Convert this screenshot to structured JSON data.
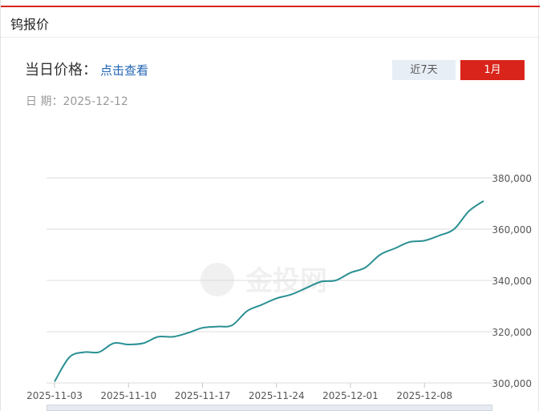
{
  "panel": {
    "title": "钨报价"
  },
  "price": {
    "label": "当日价格：",
    "link_text": "点击查看"
  },
  "date": {
    "label": "日 期：",
    "value": "2025-12-12"
  },
  "range_buttons": {
    "week": "近7天",
    "month": "1月",
    "selected": "month"
  },
  "watermark": {
    "text": "金投网"
  },
  "colors": {
    "accent": "#d9241b",
    "line": "#2a9093",
    "grid": "#dddddd",
    "link": "#1f64b4"
  },
  "chart_data": {
    "type": "line",
    "title": "",
    "xlabel": "",
    "ylabel": "",
    "ylim": [
      300000,
      380000
    ],
    "yticks": [
      300000,
      320000,
      340000,
      360000,
      380000
    ],
    "ytick_labels": [
      "300,000",
      "320,000",
      "340,000",
      "360,000",
      "380,000"
    ],
    "xtick_labels": [
      "2025-11-03",
      "2025-11-10",
      "2025-11-17",
      "2025-11-24",
      "2025-12-01",
      "2025-12-08"
    ],
    "grid": true,
    "series": [
      {
        "x": [
          "2025-11-03",
          "2025-11-04",
          "2025-11-05",
          "2025-11-06",
          "2025-11-07",
          "2025-11-10",
          "2025-11-11",
          "2025-11-12",
          "2025-11-13",
          "2025-11-14",
          "2025-11-17",
          "2025-11-18",
          "2025-11-19",
          "2025-11-20",
          "2025-11-21",
          "2025-11-24",
          "2025-11-25",
          "2025-11-26",
          "2025-11-27",
          "2025-11-28",
          "2025-12-01",
          "2025-12-02",
          "2025-12-03",
          "2025-12-04",
          "2025-12-05",
          "2025-12-08",
          "2025-12-09",
          "2025-12-10",
          "2025-12-11",
          "2025-12-12"
        ],
        "values": [
          300500,
          310000,
          312000,
          312000,
          315500,
          315000,
          315500,
          318000,
          318000,
          319500,
          321500,
          322000,
          322500,
          328000,
          330500,
          333000,
          334500,
          337000,
          339500,
          340000,
          343000,
          345000,
          350000,
          352500,
          355000,
          355500,
          357500,
          360000,
          367000,
          371000
        ]
      }
    ]
  }
}
